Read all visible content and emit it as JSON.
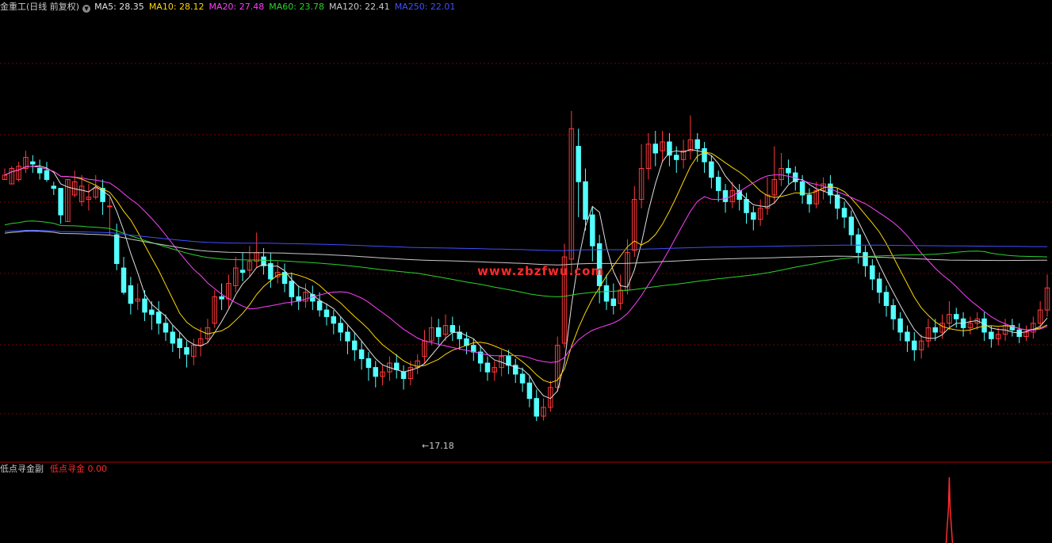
{
  "header": {
    "title": "金重工(日线 前复权)",
    "indicators": [
      {
        "label": "MA5: 28.35",
        "color": "#e0e0e0"
      },
      {
        "label": "MA10: 28.12",
        "color": "#ffd700"
      },
      {
        "label": "MA20: 27.48",
        "color": "#ff40ff"
      },
      {
        "label": "MA60: 23.78",
        "color": "#2bd32b"
      },
      {
        "label": "MA120: 22.41",
        "color": "#c8c8c8"
      },
      {
        "label": "MA250: 22.01",
        "color": "#3f4fff"
      }
    ]
  },
  "watermark": "www.zbzfwu.com",
  "low_marker": "←17.18",
  "sub_panel": {
    "title": "低点寻金副",
    "indicator_label": "低点寻金",
    "indicator_value": "0.00",
    "indicator_color": "#ff2a2a"
  },
  "colors": {
    "up": "#ff3a3a",
    "down": "#54ffff",
    "grid": "#7a0000",
    "background": "#000000"
  },
  "chart_data": {
    "type": "candlestick",
    "price_range": [
      15.5,
      35.5
    ],
    "candles_ohlc": [
      [
        28.1,
        28.3,
        28.6,
        28.2
      ],
      [
        27.9,
        28.6,
        28.7,
        28.0
      ],
      [
        28.1,
        28.7,
        28.9,
        28.0
      ],
      [
        28.6,
        29.1,
        29.4,
        28.4
      ],
      [
        28.9,
        28.8,
        29.2,
        28.4
      ],
      [
        28.6,
        28.4,
        29.0,
        28.1
      ],
      [
        28.5,
        28.1,
        28.9,
        28.0
      ],
      [
        27.8,
        27.7,
        28.0,
        27.4
      ],
      [
        27.7,
        26.5,
        27.6,
        26.1
      ],
      [
        26.2,
        28.1,
        27.5,
        26.5
      ],
      [
        27.4,
        28.0,
        28.5,
        27.3
      ],
      [
        27.1,
        27.8,
        28.3,
        26.9
      ],
      [
        27.2,
        27.3,
        27.9,
        26.7
      ],
      [
        27.3,
        27.7,
        28.3,
        27.2
      ],
      [
        27.7,
        27.1,
        28.1,
        26.5
      ],
      [
        26.9,
        26.9,
        27.3,
        25.6
      ],
      [
        25.6,
        24.3,
        26.1,
        24.0
      ],
      [
        24.1,
        23.0,
        24.6,
        22.9
      ],
      [
        23.3,
        22.5,
        23.7,
        22.0
      ],
      [
        22.6,
        22.7,
        23.4,
        22.2
      ],
      [
        22.7,
        22.1,
        23.1,
        21.7
      ],
      [
        22.2,
        22.0,
        22.6,
        21.3
      ],
      [
        22.1,
        21.6,
        22.6,
        21.1
      ],
      [
        21.6,
        21.2,
        22.0,
        20.8
      ],
      [
        21.2,
        20.7,
        21.5,
        20.3
      ],
      [
        20.9,
        20.5,
        21.2,
        20.0
      ],
      [
        20.5,
        20.2,
        20.8,
        19.6
      ],
      [
        20.1,
        20.6,
        20.9,
        19.7
      ],
      [
        20.6,
        20.9,
        21.4,
        20.1
      ],
      [
        20.9,
        21.4,
        21.8,
        20.7
      ],
      [
        21.6,
        22.8,
        23.1,
        21.4
      ],
      [
        22.8,
        22.7,
        23.4,
        22.2
      ],
      [
        22.7,
        23.4,
        23.8,
        22.3
      ],
      [
        23.3,
        24.1,
        24.6,
        23.0
      ],
      [
        24.0,
        23.9,
        24.8,
        23.5
      ],
      [
        24.0,
        24.4,
        25.1,
        23.7
      ],
      [
        24.4,
        24.8,
        25.7,
        24.1
      ],
      [
        24.6,
        24.2,
        25.0,
        23.8
      ],
      [
        24.3,
        23.6,
        24.8,
        23.2
      ],
      [
        23.7,
        23.9,
        24.4,
        23.4
      ],
      [
        23.9,
        23.4,
        24.3,
        23.0
      ],
      [
        23.5,
        22.8,
        23.9,
        22.4
      ],
      [
        22.8,
        22.6,
        23.3,
        22.2
      ],
      [
        22.6,
        23.0,
        23.4,
        22.3
      ],
      [
        22.9,
        22.6,
        23.3,
        22.2
      ],
      [
        22.6,
        22.2,
        23.0,
        21.9
      ],
      [
        22.2,
        21.9,
        22.5,
        21.5
      ],
      [
        21.9,
        21.6,
        22.2,
        21.1
      ],
      [
        21.6,
        21.2,
        21.9,
        20.8
      ],
      [
        21.2,
        20.8,
        21.5,
        20.2
      ],
      [
        20.8,
        20.4,
        21.2,
        19.9
      ],
      [
        20.4,
        20.0,
        20.8,
        19.5
      ],
      [
        20.0,
        19.6,
        20.3,
        19.0
      ],
      [
        19.6,
        19.2,
        19.9,
        18.7
      ],
      [
        19.2,
        19.4,
        19.7,
        18.8
      ],
      [
        19.4,
        19.8,
        20.1,
        19.0
      ],
      [
        19.8,
        19.5,
        20.2,
        19.1
      ],
      [
        19.4,
        19.1,
        19.7,
        18.6
      ],
      [
        19.1,
        19.6,
        19.9,
        18.8
      ],
      [
        19.6,
        19.9,
        20.2,
        19.3
      ],
      [
        20.1,
        20.8,
        21.3,
        19.8
      ],
      [
        20.8,
        21.4,
        21.9,
        20.6
      ],
      [
        21.4,
        21.0,
        21.8,
        20.6
      ],
      [
        21.1,
        21.5,
        22.0,
        20.8
      ],
      [
        21.5,
        21.2,
        21.9,
        20.8
      ],
      [
        21.2,
        20.9,
        21.5,
        20.4
      ],
      [
        20.9,
        20.6,
        21.2,
        20.2
      ],
      [
        20.6,
        20.3,
        20.9,
        19.9
      ],
      [
        20.3,
        19.8,
        20.6,
        19.4
      ],
      [
        19.8,
        19.4,
        20.1,
        19.0
      ],
      [
        19.4,
        19.6,
        19.9,
        19.0
      ],
      [
        19.6,
        20.1,
        20.4,
        19.2
      ],
      [
        20.1,
        19.7,
        20.4,
        19.3
      ],
      [
        19.7,
        19.3,
        20.0,
        18.9
      ],
      [
        19.3,
        18.9,
        19.6,
        18.5
      ],
      [
        18.9,
        18.2,
        19.2,
        17.8
      ],
      [
        18.2,
        17.4,
        18.6,
        17.18
      ],
      [
        17.4,
        17.8,
        18.2,
        17.2
      ],
      [
        17.8,
        18.7,
        19.0,
        17.6
      ],
      [
        18.7,
        20.6,
        21.0,
        18.5
      ],
      [
        20.7,
        24.6,
        25.2,
        20.5
      ],
      [
        24.5,
        30.4,
        31.2,
        23.9
      ],
      [
        29.6,
        28.0,
        30.4,
        26.4
      ],
      [
        28.0,
        26.3,
        28.6,
        25.8
      ],
      [
        26.5,
        25.1,
        26.9,
        24.4
      ],
      [
        25.2,
        23.3,
        25.6,
        22.5
      ],
      [
        23.3,
        22.6,
        23.8,
        22.2
      ],
      [
        22.7,
        22.4,
        23.4,
        22.0
      ],
      [
        22.5,
        23.1,
        23.8,
        22.2
      ],
      [
        23.1,
        24.8,
        25.4,
        22.9
      ],
      [
        24.9,
        27.2,
        27.8,
        24.6
      ],
      [
        27.2,
        28.6,
        29.7,
        26.8
      ],
      [
        28.6,
        29.7,
        30.2,
        28.1
      ],
      [
        29.7,
        29.3,
        30.3,
        28.7
      ],
      [
        29.4,
        29.8,
        30.3,
        28.9
      ],
      [
        29.8,
        29.2,
        30.2,
        28.7
      ],
      [
        29.2,
        29.0,
        29.6,
        28.4
      ],
      [
        29.0,
        29.4,
        29.9,
        28.6
      ],
      [
        29.4,
        29.9,
        31.0,
        29.0
      ],
      [
        29.9,
        29.5,
        30.2,
        28.9
      ],
      [
        29.5,
        28.9,
        29.8,
        28.4
      ],
      [
        28.9,
        28.2,
        29.2,
        27.7
      ],
      [
        28.2,
        27.6,
        28.5,
        27.1
      ],
      [
        27.6,
        27.1,
        27.9,
        26.6
      ],
      [
        27.1,
        27.6,
        28.0,
        26.8
      ],
      [
        27.6,
        27.2,
        27.9,
        26.7
      ],
      [
        27.2,
        26.6,
        27.5,
        26.1
      ],
      [
        26.6,
        26.3,
        26.9,
        25.8
      ],
      [
        26.3,
        26.8,
        27.2,
        26.0
      ],
      [
        26.8,
        27.4,
        28.2,
        26.5
      ],
      [
        27.4,
        28.1,
        29.6,
        27.0
      ],
      [
        28.1,
        28.6,
        29.3,
        27.8
      ],
      [
        28.6,
        28.4,
        29.0,
        27.9
      ],
      [
        28.4,
        28.0,
        28.7,
        27.6
      ],
      [
        28.0,
        27.4,
        28.3,
        27.0
      ],
      [
        27.4,
        27.0,
        27.7,
        26.6
      ],
      [
        27.0,
        27.6,
        28.0,
        26.8
      ],
      [
        27.6,
        27.9,
        28.2,
        27.2
      ],
      [
        27.9,
        27.4,
        28.3,
        27.0
      ],
      [
        27.4,
        26.8,
        27.7,
        26.3
      ],
      [
        26.8,
        26.4,
        27.1,
        25.9
      ],
      [
        26.4,
        25.6,
        26.7,
        25.1
      ],
      [
        25.6,
        24.8,
        25.9,
        24.3
      ],
      [
        24.8,
        24.2,
        25.1,
        23.7
      ],
      [
        24.2,
        23.6,
        24.5,
        23.1
      ],
      [
        23.6,
        23.0,
        23.9,
        22.5
      ],
      [
        23.0,
        22.4,
        23.3,
        21.9
      ],
      [
        22.4,
        21.8,
        22.7,
        21.3
      ],
      [
        21.8,
        21.2,
        22.1,
        20.8
      ],
      [
        21.2,
        20.8,
        21.5,
        20.3
      ],
      [
        20.8,
        20.4,
        21.2,
        19.9
      ],
      [
        20.4,
        20.8,
        21.1,
        20.0
      ],
      [
        20.8,
        21.4,
        21.8,
        20.5
      ],
      [
        21.4,
        21.2,
        21.8,
        20.8
      ],
      [
        21.2,
        21.6,
        22.0,
        20.9
      ],
      [
        21.6,
        22.0,
        22.6,
        21.3
      ],
      [
        22.0,
        21.8,
        22.3,
        21.4
      ],
      [
        21.8,
        21.4,
        22.1,
        21.0
      ],
      [
        21.4,
        21.6,
        21.9,
        21.1
      ],
      [
        21.6,
        21.8,
        22.1,
        21.3
      ],
      [
        21.8,
        21.2,
        22.1,
        20.8
      ],
      [
        21.2,
        20.9,
        21.5,
        20.5
      ],
      [
        20.9,
        21.1,
        21.4,
        20.6
      ],
      [
        21.1,
        21.5,
        21.8,
        20.8
      ],
      [
        21.5,
        21.3,
        21.8,
        21.0
      ],
      [
        21.3,
        21.0,
        21.6,
        20.7
      ],
      [
        21.0,
        21.2,
        21.5,
        20.8
      ],
      [
        21.2,
        21.6,
        21.9,
        20.9
      ],
      [
        21.6,
        22.2,
        22.6,
        21.4
      ],
      [
        22.2,
        23.2,
        23.8,
        21.9
      ]
    ],
    "moving_averages": [
      {
        "name": "MA5",
        "color": "#e0e0e0",
        "period": 5
      },
      {
        "name": "MA10",
        "color": "#ffd700",
        "period": 10
      },
      {
        "name": "MA20",
        "color": "#ff40ff",
        "period": 20
      },
      {
        "name": "MA60",
        "color": "#2bd32b",
        "period": 60
      },
      {
        "name": "MA120",
        "color": "#c8c8c8",
        "period": 120
      },
      {
        "name": "MA250",
        "color": "#3f4fff",
        "period": 250
      }
    ],
    "low_point": 17.18,
    "sub_indicator": {
      "name": "低点寻金",
      "spike_at_candle": 135,
      "spike_value": 1.0
    }
  }
}
